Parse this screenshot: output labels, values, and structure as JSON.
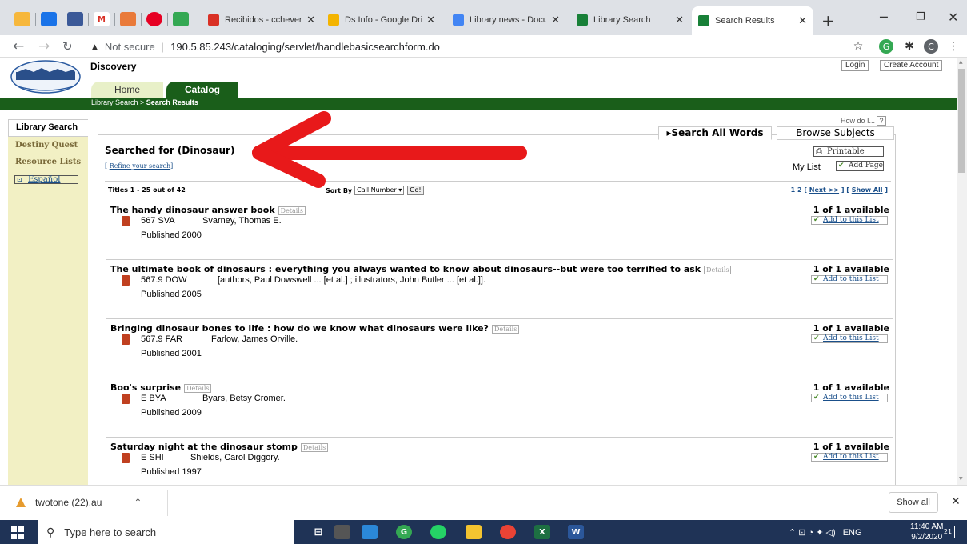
{
  "browser": {
    "tabs": [
      {
        "label": "Recibidos - ccheveri",
        "color": "#d93025"
      },
      {
        "label": "Ds Info - Google Dri",
        "color": "#f4b400"
      },
      {
        "label": "Library news - Docu",
        "color": "#4285f4"
      },
      {
        "label": "Library Search",
        "color": "#188038"
      },
      {
        "label": "Search Results",
        "color": "#188038"
      }
    ],
    "pinned_m": "M",
    "url_prefix": "Not secure",
    "url": "190.5.85.243/cataloging/servlet/handlebasicsearchform.do"
  },
  "site": {
    "name": "Discovery",
    "login": "Login",
    "create_account": "Create Account",
    "nav_tabs": [
      "Home",
      "Catalog"
    ],
    "breadcrumb_link": "Library Search",
    "breadcrumb_sep": " > ",
    "breadcrumb_current": "Search Results",
    "sidebar": {
      "active": "Library Search",
      "items": [
        "Destiny Quest",
        "Resource Lists"
      ],
      "language": "Español"
    },
    "how_do_i": "How do I...",
    "help": "?",
    "search_tabs": [
      "▸Search All Words",
      "Browse Subjects"
    ],
    "searched_for": "Searched for (Dinosaur)",
    "refine": "Refine your search",
    "printable": "Printable",
    "my_list": "My List",
    "add_page": "Add Page",
    "titles_range": "Titles 1 - 25 out of 42",
    "sort_by": "Sort By",
    "sort_value": "Call Number ▾",
    "go": "Go!",
    "pager": {
      "pages": "1 2",
      "next": "Next >>",
      "show_all": "Show All"
    },
    "details_label": "Details",
    "add_list_label": "Add to this List",
    "results": [
      {
        "title": "The handy dinosaur answer book",
        "call": "567 SVA",
        "author": "Svarney, Thomas E.",
        "published": "Published 2000",
        "availability": "1 of 1 available"
      },
      {
        "title": "The ultimate book of dinosaurs : everything you always wanted to know about dinosaurs--but were too terrified to ask",
        "call": "567.9 DOW",
        "author": "[authors, Paul Dowswell ... [et al.] ; illustrators, John Butler ... [et al.]].",
        "published": "Published 2005",
        "availability": "1 of 1 available"
      },
      {
        "title": "Bringing dinosaur bones to life : how do we know what dinosaurs were like?",
        "call": "567.9 FAR",
        "author": "Farlow, James Orville.",
        "published": "Published 2001",
        "availability": "1 of 1 available"
      },
      {
        "title": "Boo's surprise",
        "call": "E BYA",
        "author": "Byars, Betsy Cromer.",
        "published": "Published 2009",
        "availability": "1 of 1 available"
      },
      {
        "title": "Saturday night at the dinosaur stomp",
        "call": "E SHI",
        "author": "Shields, Carol Diggory.",
        "published": "Published 1997",
        "availability": "1 of 1 available"
      }
    ]
  },
  "download_bar": {
    "file": "twotone (22).au",
    "show_all": "Show all"
  },
  "taskbar": {
    "search_placeholder": "Type here to search",
    "lang": "ENG",
    "time": "11:40 AM",
    "date": "9/2/2020",
    "notifications": "21"
  },
  "annotation_color": "#e8191a"
}
